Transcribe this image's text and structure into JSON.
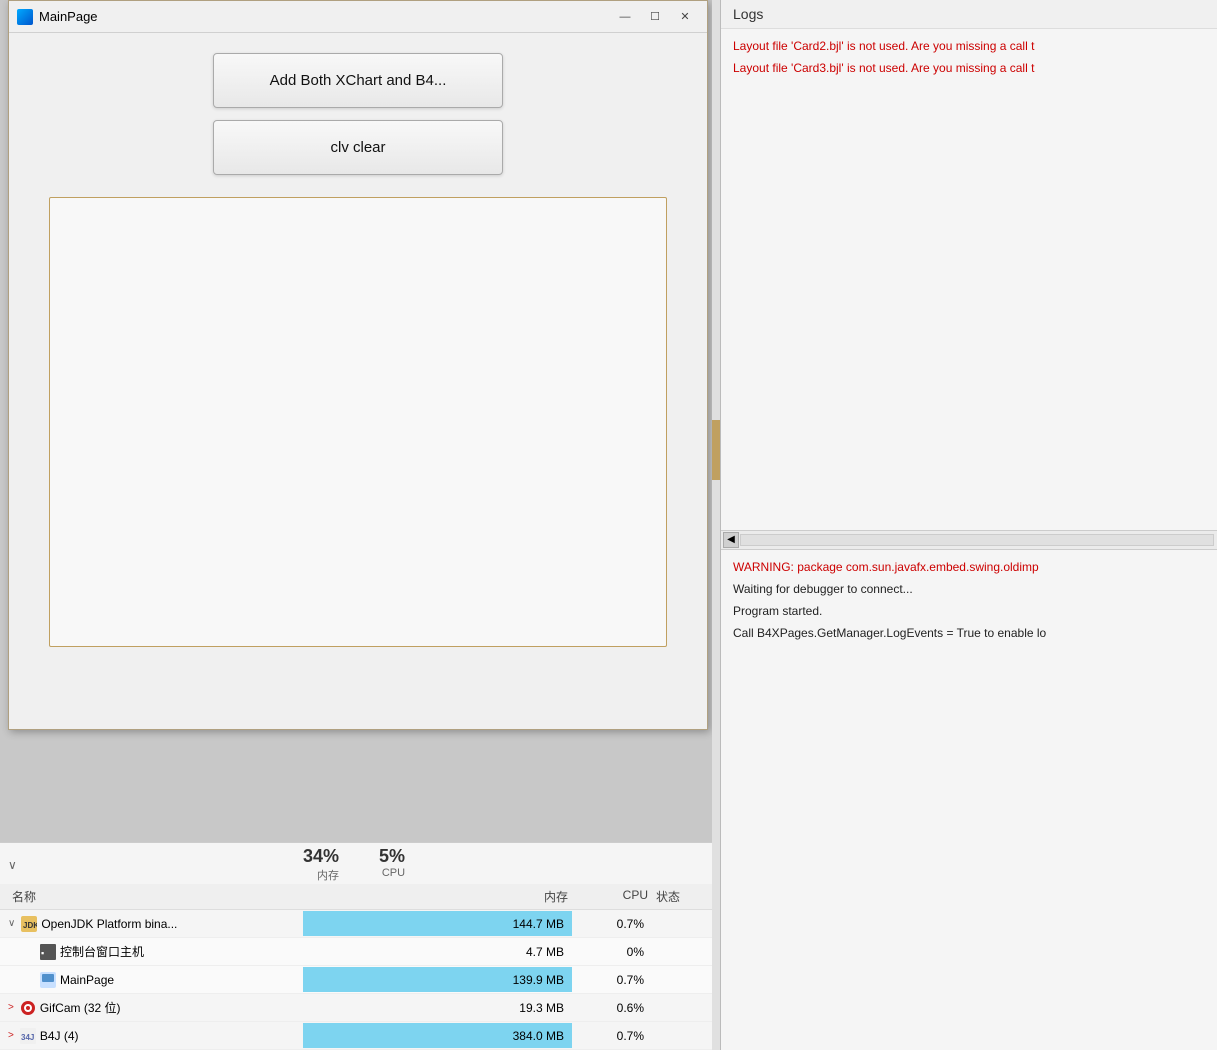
{
  "mainWindow": {
    "title": "MainPage",
    "buttons": {
      "addBoth": "Add Both XChart and B4...",
      "clvClear": "clv clear"
    },
    "controls": {
      "minimize": "—",
      "maximize": "☐",
      "close": "✕"
    }
  },
  "logs": {
    "title": "Logs",
    "lines": [
      {
        "text": "Layout file 'Card2.bjl' is not used. Are you missing a call t",
        "type": "warning"
      },
      {
        "text": "Layout file 'Card3.bjl' is not used. Are you missing a call t",
        "type": "warning"
      },
      {
        "text": "WARNING: package com.sun.javafx.embed.swing.oldimp",
        "type": "warning"
      },
      {
        "text": "Waiting for debugger to connect...",
        "type": "normal"
      },
      {
        "text": "Program started.",
        "type": "normal"
      },
      {
        "text": "Call B4XPages.GetManager.LogEvents = True to enable lo",
        "type": "normal"
      }
    ]
  },
  "taskManager": {
    "summary": {
      "memPct": "34%",
      "memLabel": "内存",
      "cpuPct": "5%",
      "cpuLabel": "CPU"
    },
    "columns": {
      "name": "名称",
      "mem": "内存",
      "cpu": "CPU",
      "status": "状态"
    },
    "processes": [
      {
        "name": "OpenJDK Platform bina...",
        "indent": false,
        "expanded": true,
        "mem": "144.7 MB",
        "cpu": "0.7%",
        "status": "",
        "memHighlight": "high",
        "hasIcon": true,
        "iconType": "java"
      },
      {
        "name": "控制台窗口主机",
        "indent": true,
        "expanded": false,
        "mem": "4.7 MB",
        "cpu": "0%",
        "status": "",
        "memHighlight": "none",
        "hasIcon": true,
        "iconType": "console"
      },
      {
        "name": "MainPage",
        "indent": true,
        "expanded": false,
        "mem": "139.9 MB",
        "cpu": "0.7%",
        "status": "",
        "memHighlight": "high",
        "hasIcon": true,
        "iconType": "app"
      },
      {
        "name": "GifCam (32 位)",
        "indent": false,
        "expanded": false,
        "mem": "19.3 MB",
        "cpu": "0.6%",
        "status": "",
        "memHighlight": "none",
        "hasIcon": true,
        "iconType": "gifcam"
      },
      {
        "name": "B4J (4)",
        "indent": false,
        "expanded": false,
        "mem": "384.0 MB",
        "cpu": "0.7%",
        "status": "",
        "memHighlight": "large",
        "hasIcon": true,
        "iconType": "b4j"
      }
    ]
  }
}
